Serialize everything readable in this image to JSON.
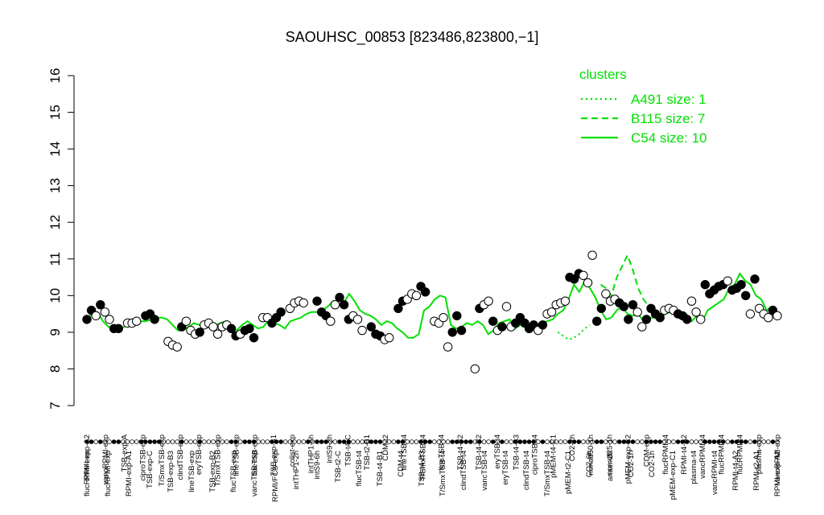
{
  "chart_data": {
    "type": "line",
    "title": "SAOUHSC_00853 [823486,823800,−1]",
    "ylim": [
      7,
      16
    ],
    "yticks": [
      7,
      8,
      9,
      10,
      11,
      12,
      13,
      14,
      15,
      16
    ],
    "legend": {
      "title": "clusters",
      "position": "top-right",
      "entries": [
        {
          "label": "A491 size: 1",
          "style": "dotted"
        },
        {
          "label": "B115 size: 7",
          "style": "dashed"
        },
        {
          "label": "C54 size: 10",
          "style": "solid"
        }
      ]
    },
    "colors": {
      "line": "#00e000",
      "point_fill_filled": "#000000",
      "point_fill_open": "#ffffff",
      "point_stroke": "#000000"
    },
    "top_labels": [
      "RPMI-exp-A2",
      "vancRPMI-exp",
      "TSB-exp-A",
      "ciproTSB-exp",
      "T/SmxTSB-exp",
      "clindTSB-exp",
      "eryTSB-exp",
      "T/SmxTSB-exp",
      "lineTSB-exp",
      "flucTSB-exp",
      "TSB-exp-B1",
      "colist-exp",
      "intTHP1-6h",
      "intS9-2h",
      "TSB-t4-C",
      "TSB-t2-B1",
      "CDM-t2",
      "lineTSB-t4",
      "T/SmxTSB-t4",
      "lineTSB-t4",
      "TSB-t4-B2",
      "TSB-t4-B2",
      "eryTSB-t4",
      "TSB-t4-B3",
      "ciproTSB-t4",
      "pMEM-t4-C1",
      "CO2-2h",
      "nonad50-1h",
      "nonad25-1h",
      "pMEM-exp-C2",
      "CDM-exp",
      "flucRPMI-t4",
      "RPMI-t4-A2",
      "vancRPMI-t4",
      "flucRPMI-t4",
      "flucRPMI-t4",
      "plasma-exp",
      "vancRPMI-exp"
    ],
    "bottom_labels": [
      "flucRPMI-exp",
      "flucRPMI-exp",
      "RPMI-exp-A1",
      "TSB-exp-C",
      "TSB-exp-B3",
      "lineTSB-exp",
      "TSB-exp-B2",
      "flucTSB-exp",
      "vancTSB-exp",
      "RPMI/FCS-exp",
      "intTHP1-2h",
      "intS9-6h",
      "TSB-t2-C",
      "flucTSB-t4",
      "TSB-t4-B1",
      "CDM-t4",
      "TSB-t4-B3",
      "T/SmxTSB-t4",
      "clindTSB-t4",
      "vancTSB-t4",
      "eryTSB-t4",
      "clindTSB-t4",
      "T/SmxTSB-t4",
      "pMEM-t2-C1",
      "CO2-6h",
      "anaer-2h",
      "CO2-1h",
      "CO2-1h",
      "pMEM-exp-C1",
      "plasma-t4",
      "vancRPMI-t4",
      "RPMI-t4-A2",
      "RPMI-t2-A1",
      "RPMI-exp-A2"
    ],
    "series": [
      {
        "name": "C54 size: 10",
        "style": "solid",
        "x": [
          1,
          2,
          3,
          4,
          5,
          6,
          7,
          8,
          9,
          10,
          11,
          12,
          13,
          14,
          15,
          16,
          17,
          18,
          19,
          20,
          21,
          22,
          23,
          24,
          25,
          26,
          27,
          28,
          29,
          30,
          31,
          32,
          33,
          34,
          35,
          36,
          37,
          38,
          39,
          40,
          41,
          42,
          43,
          44,
          45,
          46,
          47,
          48,
          49,
          50,
          51,
          52,
          53,
          54,
          55,
          56,
          57,
          58,
          59,
          60,
          61,
          62,
          63,
          64,
          65,
          66,
          67,
          68,
          69,
          70,
          71,
          72,
          73,
          74,
          75,
          76,
          77,
          78,
          79,
          80,
          81,
          82,
          83,
          84,
          85,
          86,
          87,
          88,
          89,
          90,
          91,
          92,
          93,
          94,
          95,
          96,
          97,
          98,
          99,
          100,
          101,
          102,
          103,
          104,
          105,
          106,
          107,
          108,
          109,
          110,
          111,
          112,
          113,
          114,
          115,
          116,
          117,
          118,
          119,
          120,
          121,
          122,
          123,
          124,
          125,
          126,
          127,
          128,
          129,
          130
        ],
        "values": [
          9.35,
          9.5,
          9.55,
          9.3,
          9.15,
          9.1,
          9.1,
          9.15,
          9.2,
          9.25,
          9.3,
          9.3,
          9.35,
          9.4,
          9.4,
          9.35,
          9.2,
          9.05,
          9.05,
          9.15,
          9.25,
          9.2,
          9.1,
          9.15,
          9.2,
          9.25,
          9.3,
          9.1,
          9.05,
          9.2,
          9.3,
          9.2,
          9.1,
          9.15,
          9.35,
          9.25,
          9.2,
          9.1,
          9.3,
          9.35,
          9.4,
          9.5,
          9.55,
          9.55,
          9.6,
          9.7,
          9.85,
          9.75,
          9.8,
          10.05,
          9.85,
          9.6,
          9.5,
          9.45,
          9.35,
          9.2,
          9.3,
          9.25,
          9.1,
          9.0,
          8.85,
          8.85,
          8.95,
          9.6,
          9.7,
          9.9,
          10.0,
          9.95,
          9.2,
          9.1,
          9.15,
          9.25,
          9.2,
          9.3,
          9.2,
          8.95,
          9.05,
          9.25,
          9.3,
          9.35,
          9.1,
          9.2,
          9.3,
          9.15,
          9.2,
          9.25,
          9.3,
          9.35,
          9.5,
          9.6,
          9.9,
          10.3,
          10.1,
          10.4,
          10.2,
          9.95,
          9.6,
          9.35,
          9.4,
          9.6,
          9.7,
          9.5,
          9.45,
          9.5,
          9.3,
          9.4,
          9.4,
          9.35,
          9.5,
          9.55,
          9.55,
          9.4,
          9.5,
          9.3,
          9.45,
          9.3,
          9.6,
          9.7,
          9.8,
          9.9,
          10.2,
          10.3,
          10.6,
          10.4,
          10.3,
          10.0,
          9.9,
          9.6,
          9.7,
          9.5
        ]
      },
      {
        "name": "B115 size: 7",
        "style": "dashed",
        "x": [
          97,
          98,
          99,
          100,
          101,
          102,
          103,
          104,
          105,
          106
        ],
        "values": [
          10.3,
          10.2,
          10.0,
          10.5,
          10.8,
          11.1,
          10.7,
          10.2,
          9.9,
          9.7
        ]
      },
      {
        "name": "A491 size: 1",
        "style": "dotted",
        "x": [
          89,
          90,
          91,
          92,
          93,
          94,
          95
        ],
        "values": [
          9.0,
          8.9,
          8.8,
          8.85,
          8.95,
          9.1,
          9.2
        ]
      }
    ],
    "points": [
      [
        1,
        9.35,
        1
      ],
      [
        2,
        9.6,
        1
      ],
      [
        3,
        9.45,
        0
      ],
      [
        4,
        9.75,
        1
      ],
      [
        5,
        9.55,
        0
      ],
      [
        6,
        9.35,
        0
      ],
      [
        7,
        9.1,
        1
      ],
      [
        8,
        9.1,
        1
      ],
      [
        10,
        9.25,
        0
      ],
      [
        11,
        9.25,
        0
      ],
      [
        12,
        9.3,
        0
      ],
      [
        14,
        9.45,
        1
      ],
      [
        15,
        9.5,
        1
      ],
      [
        16,
        9.35,
        1
      ],
      [
        19,
        8.75,
        0
      ],
      [
        20,
        8.65,
        0
      ],
      [
        21,
        8.6,
        0
      ],
      [
        22,
        9.15,
        1
      ],
      [
        23,
        9.3,
        0
      ],
      [
        24,
        9.05,
        0
      ],
      [
        25,
        8.95,
        0
      ],
      [
        26,
        9.0,
        1
      ],
      [
        27,
        9.2,
        0
      ],
      [
        28,
        9.25,
        0
      ],
      [
        29,
        9.15,
        0
      ],
      [
        30,
        8.95,
        0
      ],
      [
        31,
        9.15,
        0
      ],
      [
        32,
        9.2,
        0
      ],
      [
        33,
        9.1,
        1
      ],
      [
        34,
        8.9,
        1
      ],
      [
        35,
        8.95,
        0
      ],
      [
        36,
        9.05,
        1
      ],
      [
        37,
        9.1,
        1
      ],
      [
        38,
        8.85,
        1
      ],
      [
        40,
        9.4,
        0
      ],
      [
        41,
        9.4,
        0
      ],
      [
        42,
        9.25,
        1
      ],
      [
        43,
        9.4,
        1
      ],
      [
        44,
        9.55,
        1
      ],
      [
        46,
        9.65,
        0
      ],
      [
        47,
        9.8,
        0
      ],
      [
        48,
        9.85,
        0
      ],
      [
        49,
        9.8,
        0
      ],
      [
        52,
        9.85,
        1
      ],
      [
        53,
        9.55,
        1
      ],
      [
        54,
        9.45,
        1
      ],
      [
        55,
        9.3,
        0
      ],
      [
        56,
        9.75,
        0
      ],
      [
        57,
        9.95,
        1
      ],
      [
        58,
        9.75,
        1
      ],
      [
        59,
        9.35,
        1
      ],
      [
        60,
        9.45,
        0
      ],
      [
        61,
        9.35,
        0
      ],
      [
        62,
        9.05,
        0
      ],
      [
        64,
        9.15,
        1
      ],
      [
        65,
        8.95,
        1
      ],
      [
        66,
        8.9,
        1
      ],
      [
        67,
        8.8,
        0
      ],
      [
        68,
        8.85,
        0
      ],
      [
        70,
        9.65,
        1
      ],
      [
        71,
        9.85,
        1
      ],
      [
        72,
        9.9,
        0
      ],
      [
        73,
        10.05,
        0
      ],
      [
        74,
        10.0,
        0
      ],
      [
        75,
        10.25,
        1
      ],
      [
        76,
        10.1,
        1
      ],
      [
        78,
        9.3,
        0
      ],
      [
        79,
        9.25,
        0
      ],
      [
        80,
        9.4,
        0
      ],
      [
        81,
        8.6,
        0
      ],
      [
        82,
        9.0,
        1
      ],
      [
        83,
        9.45,
        1
      ],
      [
        84,
        9.05,
        1
      ],
      [
        87,
        8.0,
        0
      ],
      [
        88,
        9.65,
        1
      ],
      [
        89,
        9.75,
        0
      ],
      [
        90,
        9.85,
        0
      ],
      [
        91,
        9.3,
        1
      ],
      [
        92,
        9.05,
        0
      ],
      [
        93,
        9.15,
        1
      ],
      [
        94,
        9.7,
        0
      ],
      [
        95,
        9.15,
        0
      ],
      [
        96,
        9.25,
        1
      ],
      [
        97,
        9.4,
        1
      ],
      [
        98,
        9.25,
        1
      ],
      [
        99,
        9.1,
        1
      ],
      [
        100,
        9.2,
        1
      ],
      [
        101,
        9.05,
        0
      ],
      [
        102,
        9.2,
        1
      ],
      [
        103,
        9.5,
        0
      ],
      [
        104,
        9.55,
        0
      ],
      [
        105,
        9.75,
        0
      ],
      [
        106,
        9.8,
        0
      ],
      [
        107,
        9.85,
        0
      ],
      [
        108,
        10.5,
        1
      ],
      [
        109,
        10.45,
        1
      ],
      [
        110,
        10.6,
        1
      ],
      [
        111,
        10.55,
        0
      ],
      [
        112,
        10.35,
        0
      ],
      [
        113,
        11.1,
        0
      ],
      [
        114,
        9.3,
        1
      ],
      [
        115,
        9.65,
        1
      ],
      [
        116,
        10.05,
        0
      ],
      [
        117,
        9.85,
        0
      ],
      [
        118,
        9.9,
        0
      ],
      [
        119,
        9.8,
        1
      ],
      [
        120,
        9.7,
        1
      ],
      [
        121,
        9.35,
        1
      ],
      [
        122,
        9.75,
        1
      ],
      [
        123,
        9.55,
        0
      ],
      [
        124,
        9.15,
        0
      ],
      [
        125,
        9.35,
        1
      ],
      [
        126,
        9.65,
        1
      ],
      [
        127,
        9.5,
        1
      ],
      [
        128,
        9.4,
        1
      ],
      [
        129,
        9.6,
        0
      ],
      [
        130,
        9.65,
        0
      ],
      [
        131,
        9.6,
        0
      ],
      [
        132,
        9.5,
        1
      ],
      [
        133,
        9.45,
        1
      ],
      [
        134,
        9.35,
        1
      ],
      [
        135,
        9.85,
        0
      ],
      [
        136,
        9.55,
        0
      ],
      [
        137,
        9.35,
        0
      ],
      [
        138,
        10.3,
        1
      ],
      [
        139,
        10.05,
        1
      ],
      [
        140,
        10.15,
        1
      ],
      [
        141,
        10.25,
        1
      ],
      [
        142,
        10.3,
        1
      ],
      [
        143,
        10.4,
        0
      ],
      [
        144,
        10.15,
        1
      ],
      [
        145,
        10.2,
        1
      ],
      [
        146,
        10.3,
        1
      ],
      [
        147,
        10.0,
        1
      ],
      [
        148,
        9.5,
        0
      ],
      [
        149,
        10.45,
        1
      ],
      [
        150,
        9.65,
        0
      ],
      [
        151,
        9.5,
        0
      ],
      [
        152,
        9.4,
        0
      ],
      [
        153,
        9.6,
        1
      ],
      [
        154,
        9.45,
        0
      ]
    ]
  }
}
